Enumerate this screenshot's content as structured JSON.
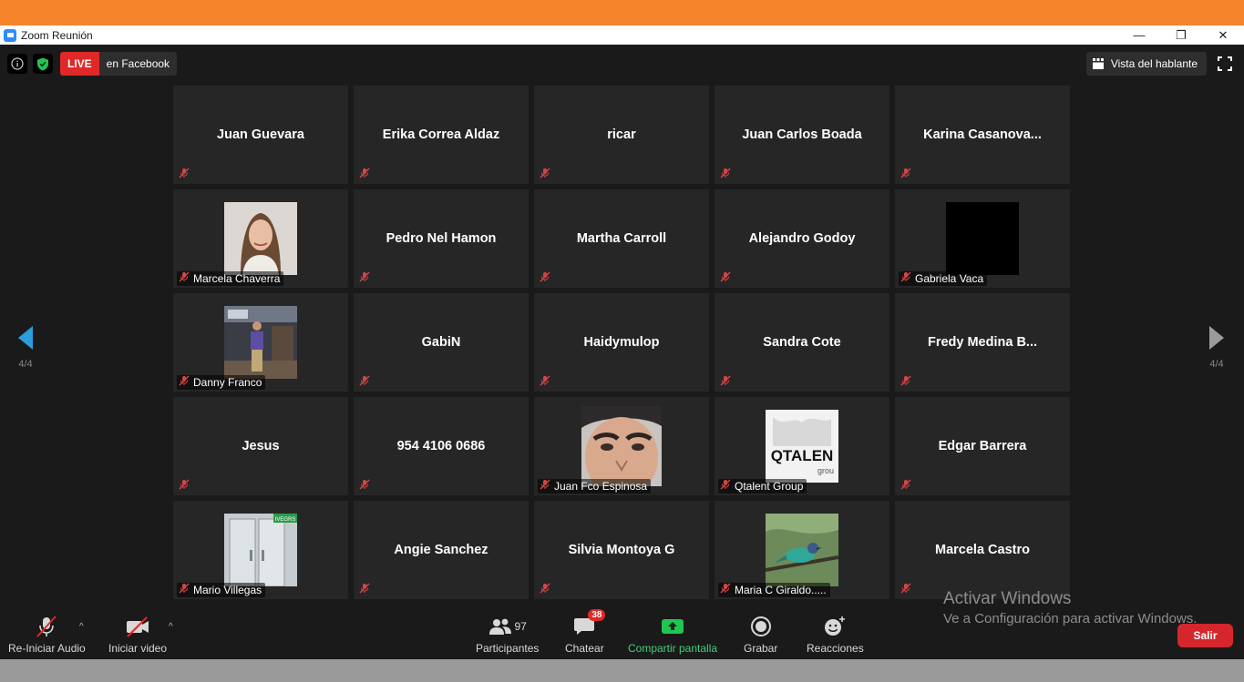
{
  "window": {
    "title": "Zoom Reunión",
    "minimize": "—",
    "restore": "❐",
    "close": "✕"
  },
  "topbar": {
    "live_badge": "LIVE",
    "live_destination": "en Facebook",
    "speaker_view": "Vista del hablante"
  },
  "nav": {
    "prev_page": "4/4",
    "next_page": "4/4"
  },
  "tiles": [
    {
      "name": "Juan Guevara",
      "has_photo": false
    },
    {
      "name": "Erika Correa Aldaz",
      "has_photo": false
    },
    {
      "name": "ricar",
      "has_photo": false
    },
    {
      "name": "Juan Carlos Boada",
      "has_photo": false
    },
    {
      "name": "Karina  Casanova...",
      "has_photo": false
    },
    {
      "name": "Marcela Chaverra",
      "has_photo": true,
      "photo_kind": "portrait-woman"
    },
    {
      "name": "Pedro Nel Hamon",
      "has_photo": false
    },
    {
      "name": "Martha Carroll",
      "has_photo": false
    },
    {
      "name": "Alejandro Godoy",
      "has_photo": false
    },
    {
      "name": "Gabriela Vaca",
      "has_photo": true,
      "photo_kind": "black-square"
    },
    {
      "name": "Danny Franco",
      "has_photo": true,
      "photo_kind": "man-indoor"
    },
    {
      "name": "GabiN",
      "has_photo": false
    },
    {
      "name": "Haidymulop",
      "has_photo": false
    },
    {
      "name": "Sandra Cote",
      "has_photo": false
    },
    {
      "name": "Fredy  Medina  B...",
      "has_photo": false
    },
    {
      "name": "Jesus",
      "has_photo": false
    },
    {
      "name": "954 4106 0686",
      "has_photo": false
    },
    {
      "name": "Juan Fco Espinosa",
      "has_photo": true,
      "photo_kind": "face-closeup"
    },
    {
      "name": "Qtalent Group",
      "has_photo": true,
      "photo_kind": "logo-qtalent",
      "logo_text": "QTALEN",
      "logo_sub": "grou"
    },
    {
      "name": "Edgar Barrera",
      "has_photo": false
    },
    {
      "name": "Mario Villegas",
      "has_photo": true,
      "photo_kind": "doors",
      "sign_text": "IVEGRS"
    },
    {
      "name": "Angie Sanchez",
      "has_photo": false
    },
    {
      "name": "Silvia Montoya G",
      "has_photo": false
    },
    {
      "name": "Maria C Giraldo.....",
      "has_photo": true,
      "photo_kind": "bird"
    },
    {
      "name": "Marcela Castro",
      "has_photo": false
    }
  ],
  "toolbar": {
    "audio_label": "Re-Iniciar Audio",
    "video_label": "Iniciar video",
    "participants_label": "Participantes",
    "participants_count": "97",
    "chat_label": "Chatear",
    "chat_badge": "38",
    "share_label": "Compartir pantalla",
    "record_label": "Grabar",
    "reactions_label": "Reacciones",
    "leave_label": "Salir"
  },
  "watermark": {
    "line1": "Activar Windows",
    "line2": "Ve a Configuración para activar Windows."
  },
  "colors": {
    "accent_orange": "#f5842b",
    "live_red": "#e02828",
    "share_green": "#3dd07a",
    "leave_red": "#d6262d",
    "nav_blue": "#2d9cdb"
  }
}
